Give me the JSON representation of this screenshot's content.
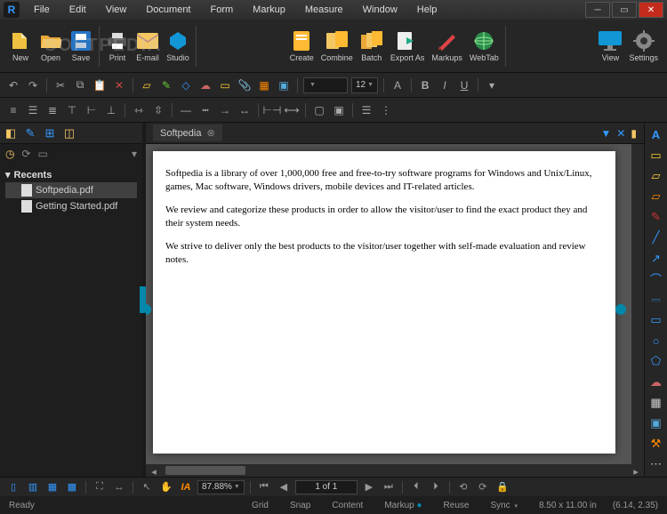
{
  "app": {
    "name": "Revu"
  },
  "menu": [
    "File",
    "Edit",
    "View",
    "Document",
    "Form",
    "Markup",
    "Measure",
    "Window",
    "Help"
  ],
  "ribbon": {
    "left": [
      {
        "key": "new",
        "label": "New"
      },
      {
        "key": "open",
        "label": "Open"
      },
      {
        "key": "save",
        "label": "Save"
      },
      {
        "key": "print",
        "label": "Print"
      },
      {
        "key": "email",
        "label": "E-mail"
      },
      {
        "key": "studio",
        "label": "Studio"
      }
    ],
    "mid": [
      {
        "key": "create",
        "label": "Create"
      },
      {
        "key": "combine",
        "label": "Combine"
      },
      {
        "key": "batch",
        "label": "Batch"
      },
      {
        "key": "exportas",
        "label": "Export As"
      },
      {
        "key": "markups",
        "label": "Markups"
      },
      {
        "key": "webtab",
        "label": "WebTab"
      }
    ],
    "right": [
      {
        "key": "view",
        "label": "View"
      },
      {
        "key": "settings",
        "label": "Settings"
      }
    ],
    "watermark": "SOFTPEDIA"
  },
  "formatbar": {
    "font": "",
    "size": "12",
    "bold": "B",
    "italic": "I",
    "underline": "U"
  },
  "sidebar": {
    "recents_label": "Recents",
    "files": [
      "Softpedia.pdf",
      "Getting Started.pdf"
    ]
  },
  "document": {
    "tab_title": "Softpedia",
    "paragraphs": [
      "Softpedia is a library of over 1,000,000 free and free-to-try software programs for Windows and Unix/Linux, games, Mac software, Windows drivers, mobile devices and IT-related articles.",
      "We review and categorize these products in order to allow the visitor/user to find the exact product they and their system needs.",
      "We strive to deliver only the best products to the visitor/user together with self-made evaluation and review notes."
    ]
  },
  "bottombar": {
    "zoom": "87.88%",
    "page_display": "1 of 1"
  },
  "status": {
    "ready": "Ready",
    "grid": "Grid",
    "snap": "Snap",
    "content": "Content",
    "markup": "Markup",
    "reuse": "Reuse",
    "sync": "Sync",
    "page_size": "8.50 x 11.00 in",
    "cursor": "(6.14, 2.35)"
  }
}
